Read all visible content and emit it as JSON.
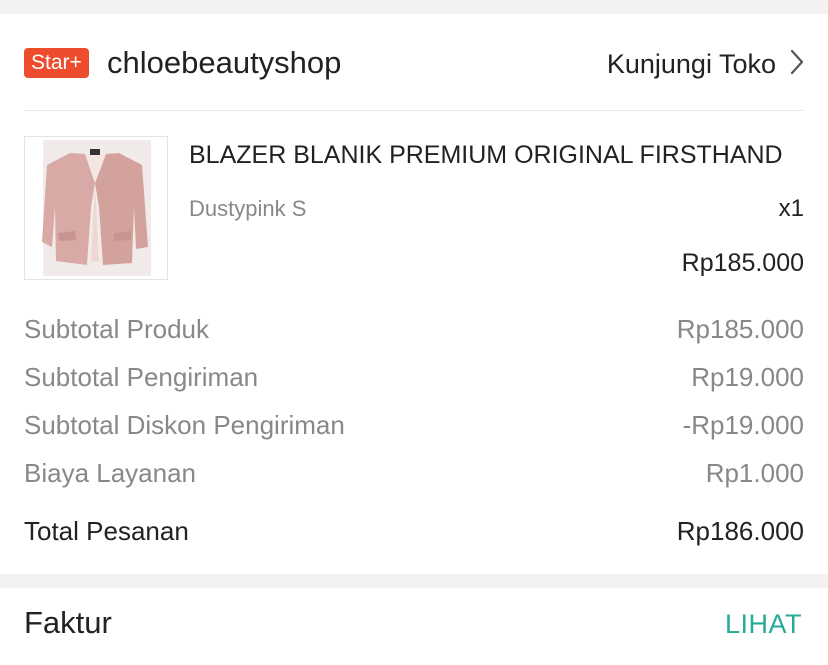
{
  "shop": {
    "badge": "Star+",
    "name": "chloebeautyshop",
    "visit_label": "Kunjungi Toko",
    "visit_icon": "chevron-right-icon"
  },
  "product": {
    "title": "BLAZER BLANIK PREMIUM ORIGINAL FIRSTHAND",
    "variant": "Dustypink S",
    "quantity": "x1",
    "price": "Rp185.000"
  },
  "summary": [
    {
      "label": "Subtotal Produk",
      "value": "Rp185.000"
    },
    {
      "label": "Subtotal Pengiriman",
      "value": "Rp19.000"
    },
    {
      "label": "Subtotal Diskon Pengiriman",
      "value": "-Rp19.000"
    },
    {
      "label": "Biaya Layanan",
      "value": "Rp1.000"
    }
  ],
  "total": {
    "label": "Total Pesanan",
    "value": "Rp186.000"
  },
  "invoice": {
    "label": "Faktur",
    "action": "LIHAT"
  },
  "colors": {
    "badge": "#ee4d2d",
    "link": "#26aa99",
    "muted": "#888888",
    "product": "#d8a9a6"
  }
}
